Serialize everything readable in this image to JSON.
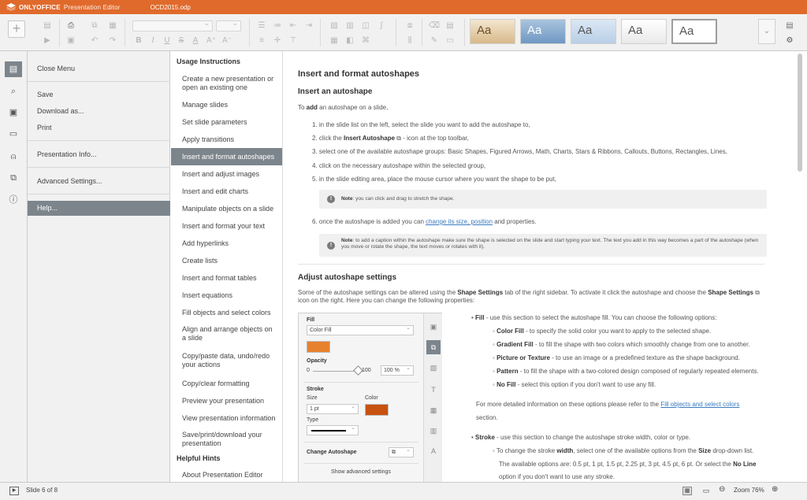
{
  "app": {
    "brand": "ONLYOFFICE",
    "product": "Presentation Editor",
    "document_title": "OCD2015.odp"
  },
  "toolbar": {
    "themes": [
      "Aa",
      "Aa",
      "Aa",
      "Aa",
      "Aa"
    ],
    "icons": [
      "add-slide-icon",
      "layout-icon",
      "print-icon",
      "save-icon",
      "copy-icon",
      "paste-icon",
      "undo-icon",
      "redo-icon",
      "bold-icon",
      "italic-icon",
      "underline-icon",
      "strikethrough-icon",
      "font-color-icon",
      "font-grow-icon",
      "font-shrink-icon",
      "bullets-icon",
      "numbering-icon",
      "indent-icon",
      "align-icon",
      "shape-icon",
      "chart-icon",
      "text-box-icon",
      "equation-icon",
      "table-icon",
      "image-icon",
      "arrange-icon",
      "clear-style-icon",
      "copy-style-icon",
      "color-scheme-icon",
      "slide-size-icon",
      "settings-icon"
    ]
  },
  "rail": {
    "icons": [
      "file-icon",
      "search-icon",
      "slides-icon",
      "comments-icon",
      "user-icon",
      "plugins-icon",
      "about-icon"
    ]
  },
  "file_menu": {
    "items": [
      "Close Menu",
      "Save",
      "Download as...",
      "Print",
      "Presentation Info...",
      "Advanced Settings...",
      "Help..."
    ]
  },
  "contents": {
    "usage_heading": "Usage Instructions",
    "items": [
      "Create a new presentation or open an existing one",
      "Manage slides",
      "Set slide parameters",
      "Apply transitions",
      "Insert and format autoshapes",
      "Insert and adjust images",
      "Insert and edit charts",
      "Manipulate objects on a slide",
      "Insert and format your text",
      "Add hyperlinks",
      "Create lists",
      "Insert and format tables",
      "Insert equations",
      "Fill objects and select colors",
      "Align and arrange objects on a slide",
      "Copy/paste data, undo/redo your actions",
      "Copy/clear formatting",
      "Preview your presentation",
      "View presentation information",
      "Save/print/download your presentation"
    ],
    "hints_heading": "Helpful Hints",
    "hints": [
      "About Presentation Editor"
    ]
  },
  "article": {
    "title": "Insert and format autoshapes",
    "sub1": "Insert an autoshape",
    "intro_pre": "To ",
    "intro_bold": "add",
    "intro_post": " an autoshape on a slide,",
    "steps": [
      "1. in the slide list on the left, select the slide you want to add the autoshape to,",
      "3. select one of the available autoshape groups: Basic Shapes, Figured Arrows, Math, Charts, Stars & Ribbons, Callouts, Buttons, Rectangles, Lines,",
      "4. click on the necessary autoshape within the selected group,",
      "5. in the slide editing area, place the mouse cursor where you want the shape to be put,"
    ],
    "step2_pre": "2. click the ",
    "step2_bold": "Insert Autoshape",
    "step2_post": " - icon at the top toolbar,",
    "note_label": "Note",
    "note1": ": you can click and drag to stretch the shape.",
    "step6_pre": "6. once the autoshape is added you can ",
    "step6_link": "change its size, position",
    "step6_post": " and properties.",
    "note2": ": to add a caption within the autoshape make sure the shape is selected on the slide and start typing your text. The text you add in this way becomes a part of the autoshape (when you move or rotate the shape, the text moves or rotates with it).",
    "sub2": "Adjust autoshape settings",
    "adjust_pre": "Some of the autoshape settings can be altered using the ",
    "adjust_bold1": "Shape Settings",
    "adjust_mid": " tab of the right sidebar. To activate it click the autoshape and choose the ",
    "adjust_bold2": "Shape Settings",
    "adjust_post": " icon on the right. Here you can change the following properties:",
    "fill_bold": "Fill",
    "fill_text": " - use this section to select the autoshape fill. You can choose the following options:",
    "fill_options": [
      {
        "name": "Color Fill",
        "desc": " - to specify the solid color you want to apply to the selected shape."
      },
      {
        "name": "Gradient Fill",
        "desc": " - to fill the shape with two colors which smoothly change from one to another."
      },
      {
        "name": "Picture or Texture",
        "desc": " - to use an image or a predefined texture as the shape background."
      },
      {
        "name": "Pattern",
        "desc": " - to fill the shape with a two-colored design composed of regularly repeated elements."
      },
      {
        "name": "No Fill",
        "desc": " - select this option if you don't want to use any fill."
      }
    ],
    "more_pre": "For more detailed information on these options please refer to the ",
    "more_link": "Fill objects and select colors",
    "more_post": "section.",
    "stroke_bold": "Stroke",
    "stroke_text": " - use this section to change the autoshape stroke width, color or type.",
    "width_pre": "To change the stroke ",
    "width_bold": "width",
    "width_mid": ", select one of the available options from the ",
    "width_bold2": "Size",
    "width_post": " drop-down list.",
    "width_line2_pre": "The available options are: 0.5 pt, 1 pt, 1.5 pt, 2.25 pt, 3 pt, 4.5 pt, 6 pt. Or select the ",
    "width_line2_bold": "No Line",
    "width_line3": "option if you don't want to use any stroke."
  },
  "shape_panel": {
    "fill_label": "Fill",
    "fill_value": "Color Fill",
    "fill_color": "#e8812f",
    "opacity_label": "Opacity",
    "opacity_min": "0",
    "opacity_max": "100",
    "opacity_value": "100 %",
    "opacity_level": 1.0,
    "stroke_label": "Stroke",
    "size_label": "Size",
    "size_value": "1 pt",
    "color_label": "Color",
    "stroke_color": "#c8520f",
    "type_label": "Type",
    "change_label": "Change Autoshape",
    "advanced_label": "Show advanced settings"
  },
  "status": {
    "slide_info": "Slide 6 of 8",
    "zoom_label": "Zoom 76%"
  },
  "colors": {
    "accent": "#e06a2b",
    "active_item": "#7d858c"
  }
}
